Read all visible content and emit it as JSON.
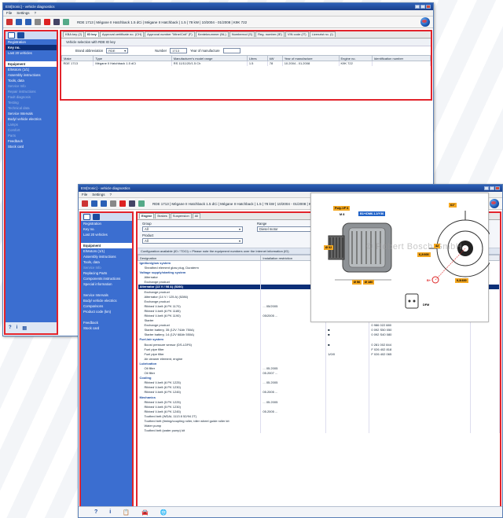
{
  "app_title": "ESI[tronic] - vehicle diagnostics",
  "menu": [
    "File",
    "Settings",
    "?"
  ],
  "vehicle_path_1": "RDE 1713 | Mégane II Hatchback 1.5 dCi | Mégane II Hatchback | 1.5 | 78 kW | 10/2004 - 01/2008 | K9K 722",
  "vehicle_path_2": "RDE 1713 | Mégane II Hatchback 1.5 dCi | Mégane II Hatchback | 1.5 | 78 kW | 10/2004 - 01/2008 | K9K 722",
  "sidebar1": {
    "items": [
      {
        "label": "Registration",
        "cls": ""
      },
      {
        "label": "Key no.",
        "cls": "sel"
      },
      {
        "label": "Last 20 vehicles",
        "cls": ""
      },
      {
        "label": "",
        "cls": ""
      },
      {
        "label": "Equipment",
        "cls": "hdr"
      },
      {
        "label": "E/Motors (1/1)",
        "cls": ""
      },
      {
        "label": "Assembly instructions",
        "cls": ""
      },
      {
        "label": "Tools, data",
        "cls": ""
      },
      {
        "label": "Service Info",
        "cls": "dim"
      },
      {
        "label": "Repair instructions",
        "cls": "dim"
      },
      {
        "label": "Fault diagnosis",
        "cls": "dim"
      },
      {
        "label": "Testing",
        "cls": "dim"
      },
      {
        "label": "Technical data",
        "cls": "dim"
      },
      {
        "label": "Service Intervals",
        "cls": ""
      },
      {
        "label": "Body/ vehicle electrics",
        "cls": ""
      },
      {
        "label": "Lamps",
        "cls": "dim"
      },
      {
        "label": "Comfort",
        "cls": "dim"
      },
      {
        "label": "Parts",
        "cls": "dim"
      },
      {
        "label": "Feedback",
        "cls": ""
      },
      {
        "label": "Stock card",
        "cls": ""
      }
    ]
  },
  "tabs1": [
    {
      "label": "KBA key (2)",
      "active": false
    },
    {
      "label": "ID key",
      "active": true
    },
    {
      "label": "Approval certificate no. (CH)",
      "active": false
    },
    {
      "label": "Approval number \"Mine/Cnit\" (F)",
      "active": false
    },
    {
      "label": "Kenteknummer (NL)",
      "active": false
    },
    {
      "label": "Numberrod (S)",
      "active": false
    },
    {
      "label": "Reg. number (IE)",
      "active": false
    },
    {
      "label": "VIN code (IT)",
      "active": false
    },
    {
      "label": "Lizenzist no. (I)",
      "active": false
    }
  ],
  "w1_form": {
    "title": "Vehicle selection with RDE ID key",
    "brand_label": "Brand abbreviation",
    "brand_value": "RDE",
    "number_label": "Number",
    "number_value": "1713",
    "year_label": "Year of manufacture",
    "year_value": ""
  },
  "w1_table": {
    "headers": [
      "Make",
      "Type",
      "Manufacturer's model range",
      "Litres",
      "kW",
      "Year of manufacture",
      "Engine no.",
      "Identification number"
    ],
    "rows": [
      [
        "RDE 1713",
        "Mégane II Hatchback 1.5 dCi",
        "RS 11/11/20/1.5 Ch",
        "1.5",
        "78",
        "10.2004 - 01.2008",
        "K9K 722",
        ""
      ]
    ]
  },
  "sidebar2": {
    "items": [
      {
        "label": "Registration",
        "cls": ""
      },
      {
        "label": "Key no.",
        "cls": ""
      },
      {
        "label": "Last 20 vehicles",
        "cls": ""
      },
      {
        "label": "",
        "cls": ""
      },
      {
        "label": "Equipment",
        "cls": "hdr"
      },
      {
        "label": "E/Motors (1/1)",
        "cls": ""
      },
      {
        "label": "Assembly instructions",
        "cls": ""
      },
      {
        "label": "Tools, data",
        "cls": ""
      },
      {
        "label": "Service Info",
        "cls": "dim"
      },
      {
        "label": "Replacing Parts",
        "cls": ""
      },
      {
        "label": "Components instructions",
        "cls": ""
      },
      {
        "label": "Special information",
        "cls": ""
      },
      {
        "label": "",
        "cls": ""
      },
      {
        "label": "Service Intervals",
        "cls": ""
      },
      {
        "label": "Body/ vehicle electrics",
        "cls": ""
      },
      {
        "label": "Comparisons",
        "cls": ""
      },
      {
        "label": "Product code (km)",
        "cls": ""
      },
      {
        "label": "",
        "cls": ""
      },
      {
        "label": "Feedback",
        "cls": ""
      },
      {
        "label": "Stock card",
        "cls": ""
      }
    ]
  },
  "tabs2": [
    {
      "label": "Engine",
      "active": true
    },
    {
      "label": "Brakes",
      "active": false
    },
    {
      "label": "Suspension",
      "active": false
    },
    {
      "label": "All",
      "active": false
    }
  ],
  "w2_filters": {
    "group_label": "Group",
    "group_value": "All",
    "range_label": "Range",
    "range_value": "Diesel motor",
    "product_label": "Product",
    "product_value": "All"
  },
  "w2_notice": "Configuration available (ID / TDCi) = Please note the equipment numbers over the Internet information (ID)",
  "parts": {
    "headers": [
      "Designation",
      "Installation restriction",
      "Info",
      "Order number",
      "Q"
    ],
    "rows": [
      {
        "c": [
          "Ignition/glow system",
          "",
          "",
          "",
          ""
        ],
        "cls": "cat"
      },
      {
        "c": [
          "Sheathed element glow plug, Duraterm",
          "",
          "",
          "0 250 202 022",
          ""
        ],
        "cls": "sub"
      },
      {
        "c": [
          "Voltage supply/starting system",
          "",
          "",
          "",
          ""
        ],
        "cls": "cat"
      },
      {
        "c": [
          "Alternator",
          "",
          "125",
          "0 124 525 117 REI",
          ""
        ],
        "cls": "sub"
      },
      {
        "c": [
          "Exchange product",
          "",
          "",
          "0 986 049 410",
          ""
        ],
        "cls": "sub"
      },
      {
        "c": [
          "Alternator (13 V / 98 A) (5286)",
          "",
          "98 / 3/8",
          "0 124 525 493",
          "1"
        ],
        "cls": "hi"
      },
      {
        "c": [
          "Exchange product",
          "",
          "1/0/0",
          "0 986 041 805",
          ""
        ],
        "cls": "sub"
      },
      {
        "c": [
          "Alternator (14 V / 125 A) (5286)",
          "",
          "■ 150 RPM",
          "0 124 525 426",
          "1"
        ],
        "cls": "sub"
      },
      {
        "c": [
          "Exchange product",
          "",
          "",
          "0 986 085 480",
          ""
        ],
        "cls": "sub"
      },
      {
        "c": [
          "Ribbed V-belt (6 PK 1170)",
          "... 05/2005",
          "1/1.1",
          "1 987 946 428",
          ""
        ],
        "cls": "sub"
      },
      {
        "c": [
          "Ribbed V-belt (6 PK 1185)",
          "",
          "1/1",
          "1 987 946 410",
          ""
        ],
        "cls": "sub"
      },
      {
        "c": [
          "Ribbed V-belt (6 PK 1190)",
          "05/2005 ...",
          "1/1.1",
          "1 987 946 421",
          ""
        ],
        "cls": "sub"
      },
      {
        "c": [
          "Starter",
          "",
          "",
          "RDS 02/97/00 E475",
          ""
        ],
        "cls": "sub"
      },
      {
        "c": [
          "Exchange product",
          "",
          "",
          "0 986 022 880",
          ""
        ],
        "cls": "sub"
      },
      {
        "c": [
          "Starter battery, 35 (12V 74Ah 750A)",
          "",
          "■",
          "0 092 S50 050",
          ""
        ],
        "cls": "sub"
      },
      {
        "c": [
          "Starter battery, 14 (12V 68Ah 550A)",
          "",
          "■",
          "0 092 S40 080",
          ""
        ],
        "cls": "sub"
      },
      {
        "c": [
          "Fuel-/air system",
          "",
          "",
          "",
          ""
        ],
        "cls": "cat"
      },
      {
        "c": [
          "Boost pressure sensor (DS-LDF6)",
          "",
          "■",
          "0 281 002 844",
          ""
        ],
        "cls": "sub"
      },
      {
        "c": [
          "Fuel pipe filter",
          "",
          "",
          "F 026 402 818",
          ""
        ],
        "cls": "sub"
      },
      {
        "c": [
          "Fuel pipe filter",
          "",
          "1/0/0",
          "F 026 402 065",
          ""
        ],
        "cls": "sub"
      },
      {
        "c": [
          "Air cleaner element, engine",
          "",
          "",
          "",
          ""
        ],
        "cls": "sub"
      },
      {
        "c": [
          "Lubrication",
          "",
          "",
          "",
          ""
        ],
        "cls": "cat"
      },
      {
        "c": [
          "Oil filter",
          "... 05.2005",
          "",
          "",
          " "
        ],
        "cls": "sub"
      },
      {
        "c": [
          "Oil filter",
          "05.2007 ...",
          "",
          "",
          ""
        ],
        "cls": "sub"
      },
      {
        "c": [
          "Cooling",
          "",
          "",
          "",
          ""
        ],
        "cls": "cat"
      },
      {
        "c": [
          "Ribbed V-belt (6 PK 1225)",
          "... 05.2005",
          "",
          "",
          ""
        ],
        "cls": "sub"
      },
      {
        "c": [
          "Ribbed V-belt (6 PK 1230)",
          "",
          "",
          "",
          ""
        ],
        "cls": "sub"
      },
      {
        "c": [
          "Ribbed V-belt (6 PK 1245)",
          "05.2005 ...",
          "",
          "",
          ""
        ],
        "cls": "sub"
      },
      {
        "c": [
          "Mechanics",
          "",
          "",
          "",
          ""
        ],
        "cls": "cat"
      },
      {
        "c": [
          "Ribbed V-belt (5 PK 1225)",
          "... 05.2005",
          "",
          "",
          ""
        ],
        "cls": "sub"
      },
      {
        "c": [
          "Ribbed V-belt (5 PK 1230)",
          "",
          "",
          "",
          ""
        ],
        "cls": "sub"
      },
      {
        "c": [
          "Ribbed V-belt (6 PK 1245)",
          "05.2005 ...",
          "",
          "",
          ""
        ],
        "cls": "sub"
      },
      {
        "c": [
          "Toothed belt (WDAL 1113 8 52/94 2T)",
          "",
          "",
          "",
          ""
        ],
        "cls": "sub"
      },
      {
        "c": [
          "Toothed belt (timing/coupling roller, idler wheel guide roller kit",
          "",
          "",
          "",
          ""
        ],
        "cls": "sub"
      },
      {
        "c": [
          "Water pump",
          "",
          "",
          "",
          ""
        ],
        "cls": "sub"
      },
      {
        "c": [
          "Toothed belt (water pump) kit",
          "",
          "",
          "",
          ""
        ],
        "cls": "sub"
      }
    ]
  },
  "image": {
    "watermark": "© Robert Bosch GmbH",
    "labels": [
      "Poly-VF 6",
      "M 8",
      "B1+/DM6.1.2/Y36",
      "Ø 56",
      "Ø 180",
      "Ø 92",
      "61°",
      "42",
      "6,2/400",
      "0,3/400",
      "DFM",
      "B+"
    ]
  },
  "bottom_icons": [
    "?",
    "i",
    "📋",
    "🚘",
    "🌐"
  ]
}
